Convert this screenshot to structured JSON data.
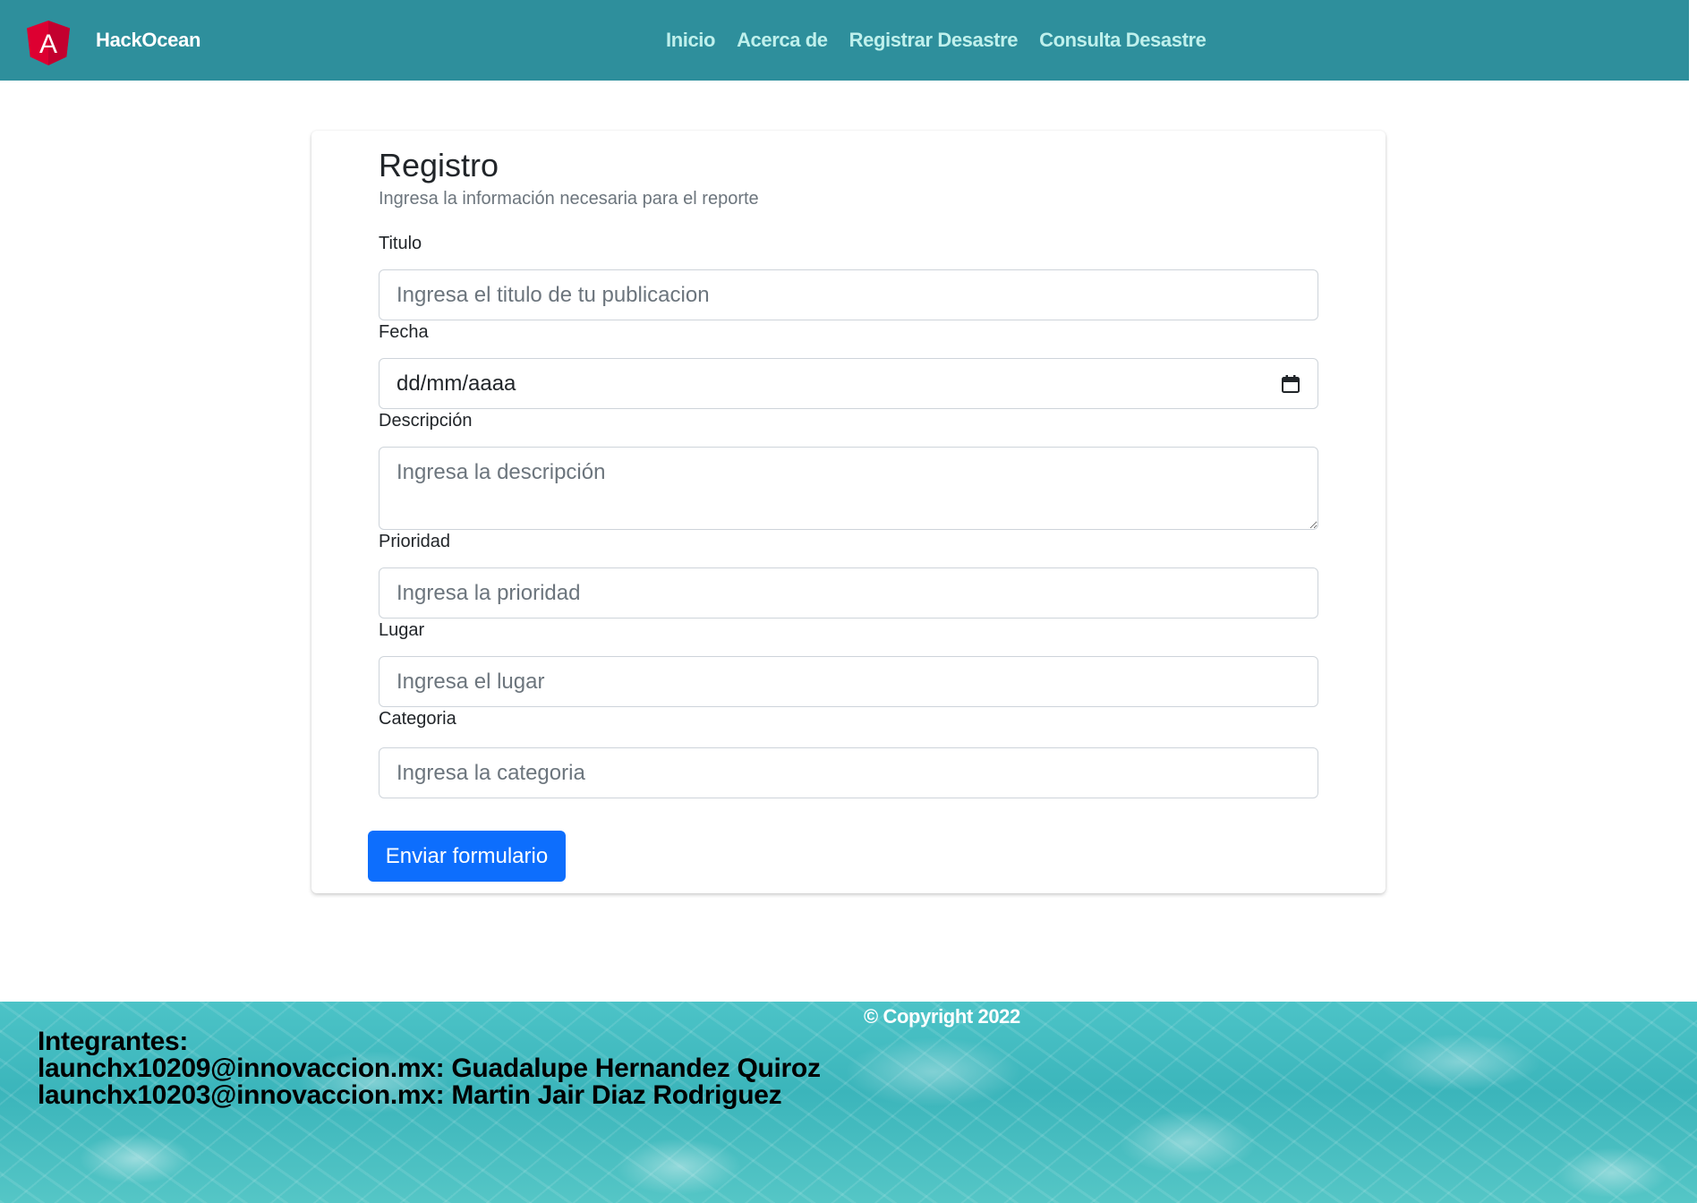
{
  "header": {
    "brand": "HackOcean",
    "logo_letter": "A",
    "nav": [
      {
        "label": "Inicio"
      },
      {
        "label": "Acerca de"
      },
      {
        "label": "Registrar Desastre"
      },
      {
        "label": "Consulta Desastre"
      }
    ]
  },
  "form": {
    "title": "Registro",
    "subtitle": "Ingresa la información necesaria para el reporte",
    "fields": {
      "titulo": {
        "label": "Titulo",
        "placeholder": "Ingresa el titulo de tu publicacion"
      },
      "fecha": {
        "label": "Fecha",
        "value": "dd/mm/aaaa"
      },
      "descripcion": {
        "label": "Descripción",
        "placeholder": "Ingresa la descripción"
      },
      "prioridad": {
        "label": "Prioridad",
        "placeholder": "Ingresa la prioridad"
      },
      "lugar": {
        "label": "Lugar",
        "placeholder": "Ingresa el lugar"
      },
      "categoria": {
        "label": "Categoria",
        "placeholder": "Ingresa la categoria"
      }
    },
    "submit_label": "Enviar formulario"
  },
  "footer": {
    "copyright": "© Copyright 2022",
    "members_heading": "Integrantes:",
    "members": [
      "launchx10209@innovaccion.mx: Guadalupe Hernandez Quiroz",
      "launchx10203@innovaccion.mx: Martin Jair Diaz Rodriguez"
    ]
  },
  "colors": {
    "navbar": "#2e8f9c",
    "nav_link": "#bff0ec",
    "primary_button": "#0d6efd",
    "logo_red": "#dd0031"
  },
  "icons": {
    "brand_logo": "angular-logo-icon",
    "date_picker": "calendar-icon"
  }
}
